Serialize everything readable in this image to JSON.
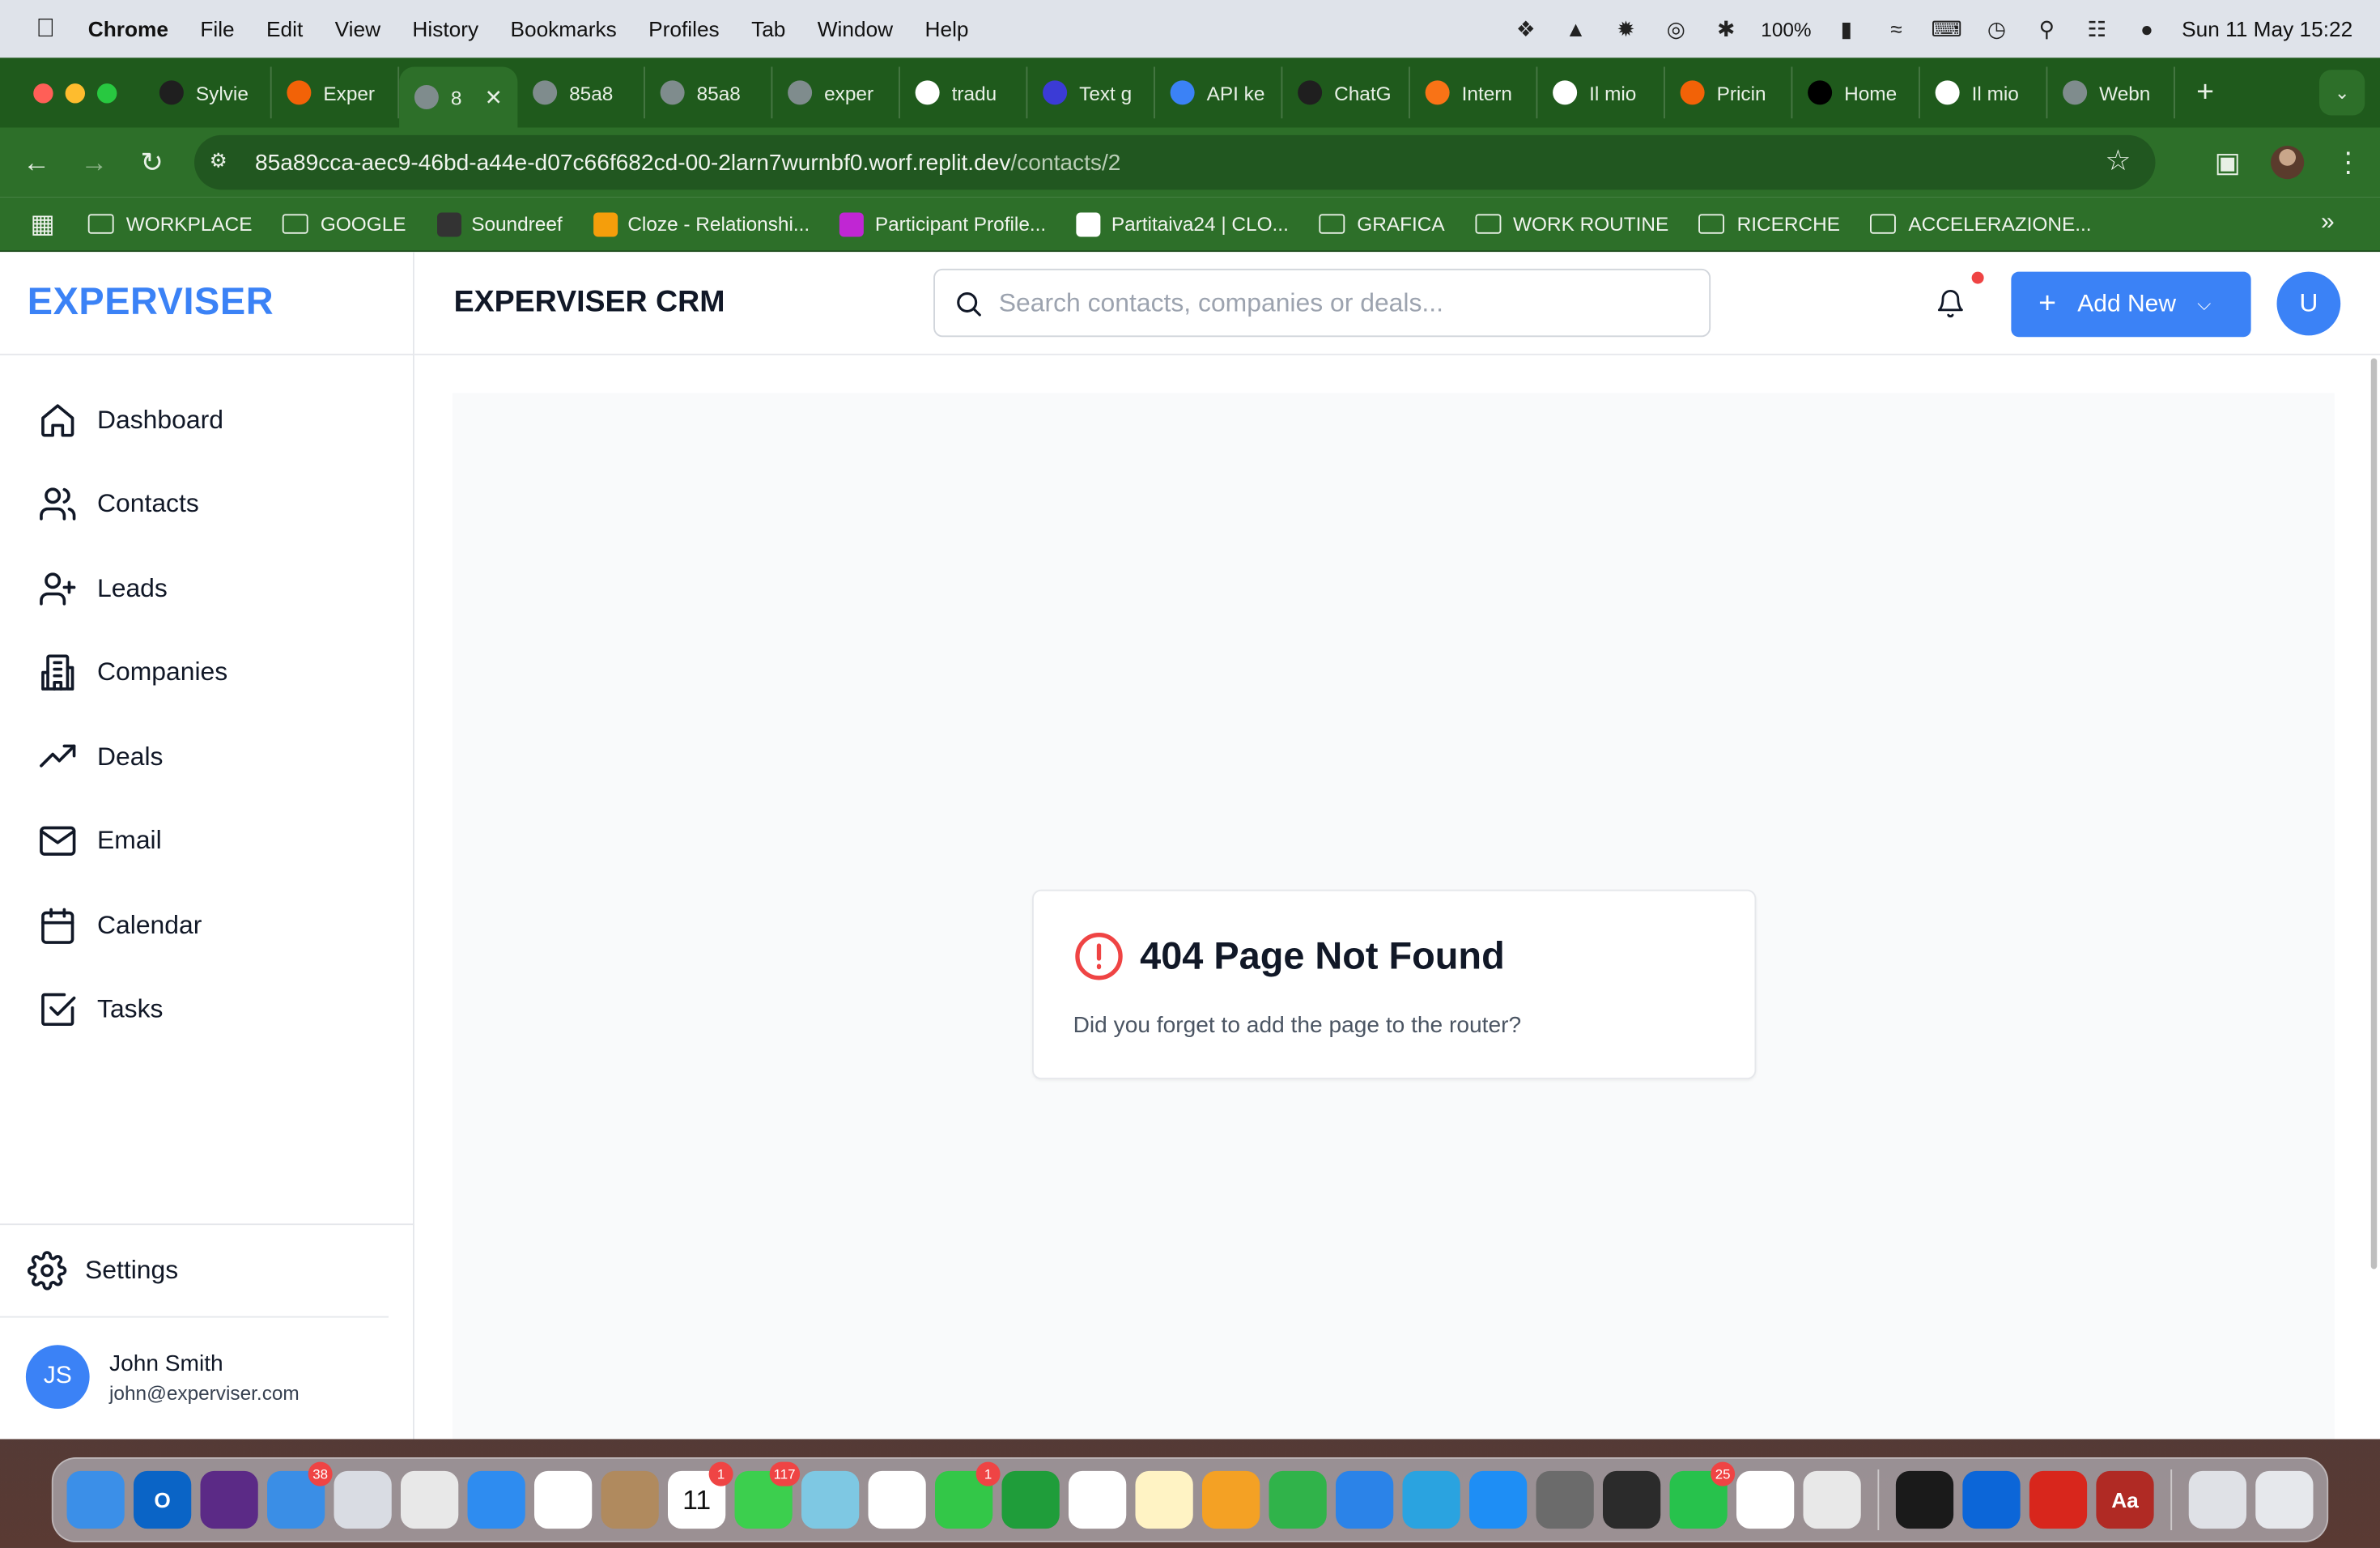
{
  "menubar": {
    "app_name": "Chrome",
    "items": [
      "File",
      "Edit",
      "View",
      "History",
      "Bookmarks",
      "Profiles",
      "Tab",
      "Window",
      "Help"
    ],
    "battery": "100%",
    "datetime": "Sun 11 May  15:22"
  },
  "browser": {
    "tabs": [
      {
        "label": "Sylvie",
        "icon": "p-logo-icon",
        "color": "#1f1f1f"
      },
      {
        "label": "Exper",
        "icon": "replit-icon",
        "color": "#f26207"
      },
      {
        "label": "8",
        "icon": "globe-icon",
        "color": "#7f8c8d",
        "active": true
      },
      {
        "label": "85a8",
        "icon": "globe-icon",
        "color": "#7f8c8d"
      },
      {
        "label": "85a8",
        "icon": "globe-icon",
        "color": "#7f8c8d"
      },
      {
        "label": "exper",
        "icon": "globe-icon",
        "color": "#7f8c8d"
      },
      {
        "label": "tradu",
        "icon": "google-icon",
        "color": "#ffffff"
      },
      {
        "label": "Text g",
        "icon": "openai-blue-icon",
        "color": "#3b3bd6"
      },
      {
        "label": "API ke",
        "icon": "openai-blue-icon",
        "color": "#3b82f6"
      },
      {
        "label": "ChatG",
        "icon": "chatgpt-icon",
        "color": "#1f1f1f"
      },
      {
        "label": "Intern",
        "icon": "orange-circle-icon",
        "color": "#f97316"
      },
      {
        "label": "Il mio",
        "icon": "green-circle-icon",
        "color": "#ffffff"
      },
      {
        "label": "Pricin",
        "icon": "replit-icon",
        "color": "#f26207"
      },
      {
        "label": "Home",
        "icon": "x-icon",
        "color": "#000000"
      },
      {
        "label": "Il mio",
        "icon": "green-circle-icon",
        "color": "#ffffff"
      },
      {
        "label": "Webn",
        "icon": "globe-icon",
        "color": "#7f8c8d"
      }
    ],
    "url_host": "85a89cca-aec9-46bd-a44e-d07c66f682cd-00-2larn7wurnbf0.worf.replit.dev",
    "url_path": "/contacts/2",
    "bookmarks": [
      {
        "label": "WORKPLACE",
        "type": "folder"
      },
      {
        "label": "GOOGLE",
        "type": "folder"
      },
      {
        "label": "Soundreef",
        "type": "site",
        "color": "#333333"
      },
      {
        "label": "Cloze - Relationshi...",
        "type": "site",
        "color": "#f59e0b"
      },
      {
        "label": "Participant Profile...",
        "type": "site",
        "color": "#c026d3"
      },
      {
        "label": "Partitaiva24 | CLO...",
        "type": "site",
        "color": "#ffffff"
      },
      {
        "label": "GRAFICA",
        "type": "folder"
      },
      {
        "label": "WORK ROUTINE",
        "type": "folder"
      },
      {
        "label": "RICERCHE",
        "type": "folder"
      },
      {
        "label": "ACCELERAZIONE...",
        "type": "folder"
      }
    ]
  },
  "app": {
    "brand": "EXPERVISER",
    "header_title": "EXPERVISER CRM",
    "search_placeholder": "Search contacts, companies or deals...",
    "add_new_label": "Add New",
    "user_avatar": "U",
    "nav": [
      {
        "label": "Dashboard",
        "icon": "home-icon"
      },
      {
        "label": "Contacts",
        "icon": "users-icon"
      },
      {
        "label": "Leads",
        "icon": "user-plus-icon"
      },
      {
        "label": "Companies",
        "icon": "building-icon"
      },
      {
        "label": "Deals",
        "icon": "trending-up-icon"
      },
      {
        "label": "Email",
        "icon": "mail-icon"
      },
      {
        "label": "Calendar",
        "icon": "calendar-icon"
      },
      {
        "label": "Tasks",
        "icon": "check-square-icon"
      }
    ],
    "settings_label": "Settings",
    "profile": {
      "initials": "JS",
      "name": "John Smith",
      "email": "john@experviser.com"
    },
    "error": {
      "title": "404 Page Not Found",
      "message": "Did you forget to add the page to the router?"
    },
    "colors": {
      "accent": "#3b82f6",
      "error": "#ef4444"
    }
  },
  "dock": {
    "apps": [
      {
        "name": "finder",
        "color": "#3b8fe8"
      },
      {
        "name": "outlook",
        "color": "#0a64c6",
        "label": "O"
      },
      {
        "name": "siri",
        "color": "#5b2a86"
      },
      {
        "name": "mail",
        "color": "#3a8ee6",
        "badge": "38"
      },
      {
        "name": "launchpad",
        "color": "#d9dce3"
      },
      {
        "name": "chrome",
        "color": "#e8e8e8"
      },
      {
        "name": "safari",
        "color": "#2e8cf0"
      },
      {
        "name": "opera",
        "color": "#ffffff"
      },
      {
        "name": "contacts",
        "color": "#b08a5e"
      },
      {
        "name": "calendar",
        "color": "#ffffff",
        "label": "11",
        "badge": "1"
      },
      {
        "name": "messages",
        "color": "#3ccf4e",
        "badge": "117"
      },
      {
        "name": "maps",
        "color": "#7ec8e3"
      },
      {
        "name": "photos",
        "color": "#ffffff"
      },
      {
        "name": "facetime",
        "color": "#33c748",
        "badge": "1"
      },
      {
        "name": "chat",
        "color": "#1f9d3a"
      },
      {
        "name": "evernote",
        "color": "#ffffff"
      },
      {
        "name": "notes",
        "color": "#fff3c4"
      },
      {
        "name": "pages",
        "color": "#f4a124"
      },
      {
        "name": "numbers",
        "color": "#30b34a"
      },
      {
        "name": "keynote",
        "color": "#2b83e8"
      },
      {
        "name": "telegram",
        "color": "#2aa3e0"
      },
      {
        "name": "app-store",
        "color": "#1e8ef5"
      },
      {
        "name": "system-settings",
        "color": "#6b6b6b"
      },
      {
        "name": "phone",
        "color": "#2b2b2b"
      },
      {
        "name": "whatsapp",
        "color": "#27c24c",
        "badge": "25"
      },
      {
        "name": "chatgpt",
        "color": "#ffffff"
      },
      {
        "name": "iphone-mirroring",
        "color": "#e8e8e8"
      },
      {
        "name": "spotify",
        "color": "#1a1a1a"
      },
      {
        "name": "trello",
        "color": "#0c66d8"
      },
      {
        "name": "acrobat",
        "color": "#d8261c"
      },
      {
        "name": "dictionary",
        "color": "#b02a24",
        "label": "Aa"
      },
      {
        "name": "downloads",
        "color": "#dfe1e6"
      },
      {
        "name": "trash",
        "color": "#e6e8ec"
      }
    ]
  }
}
